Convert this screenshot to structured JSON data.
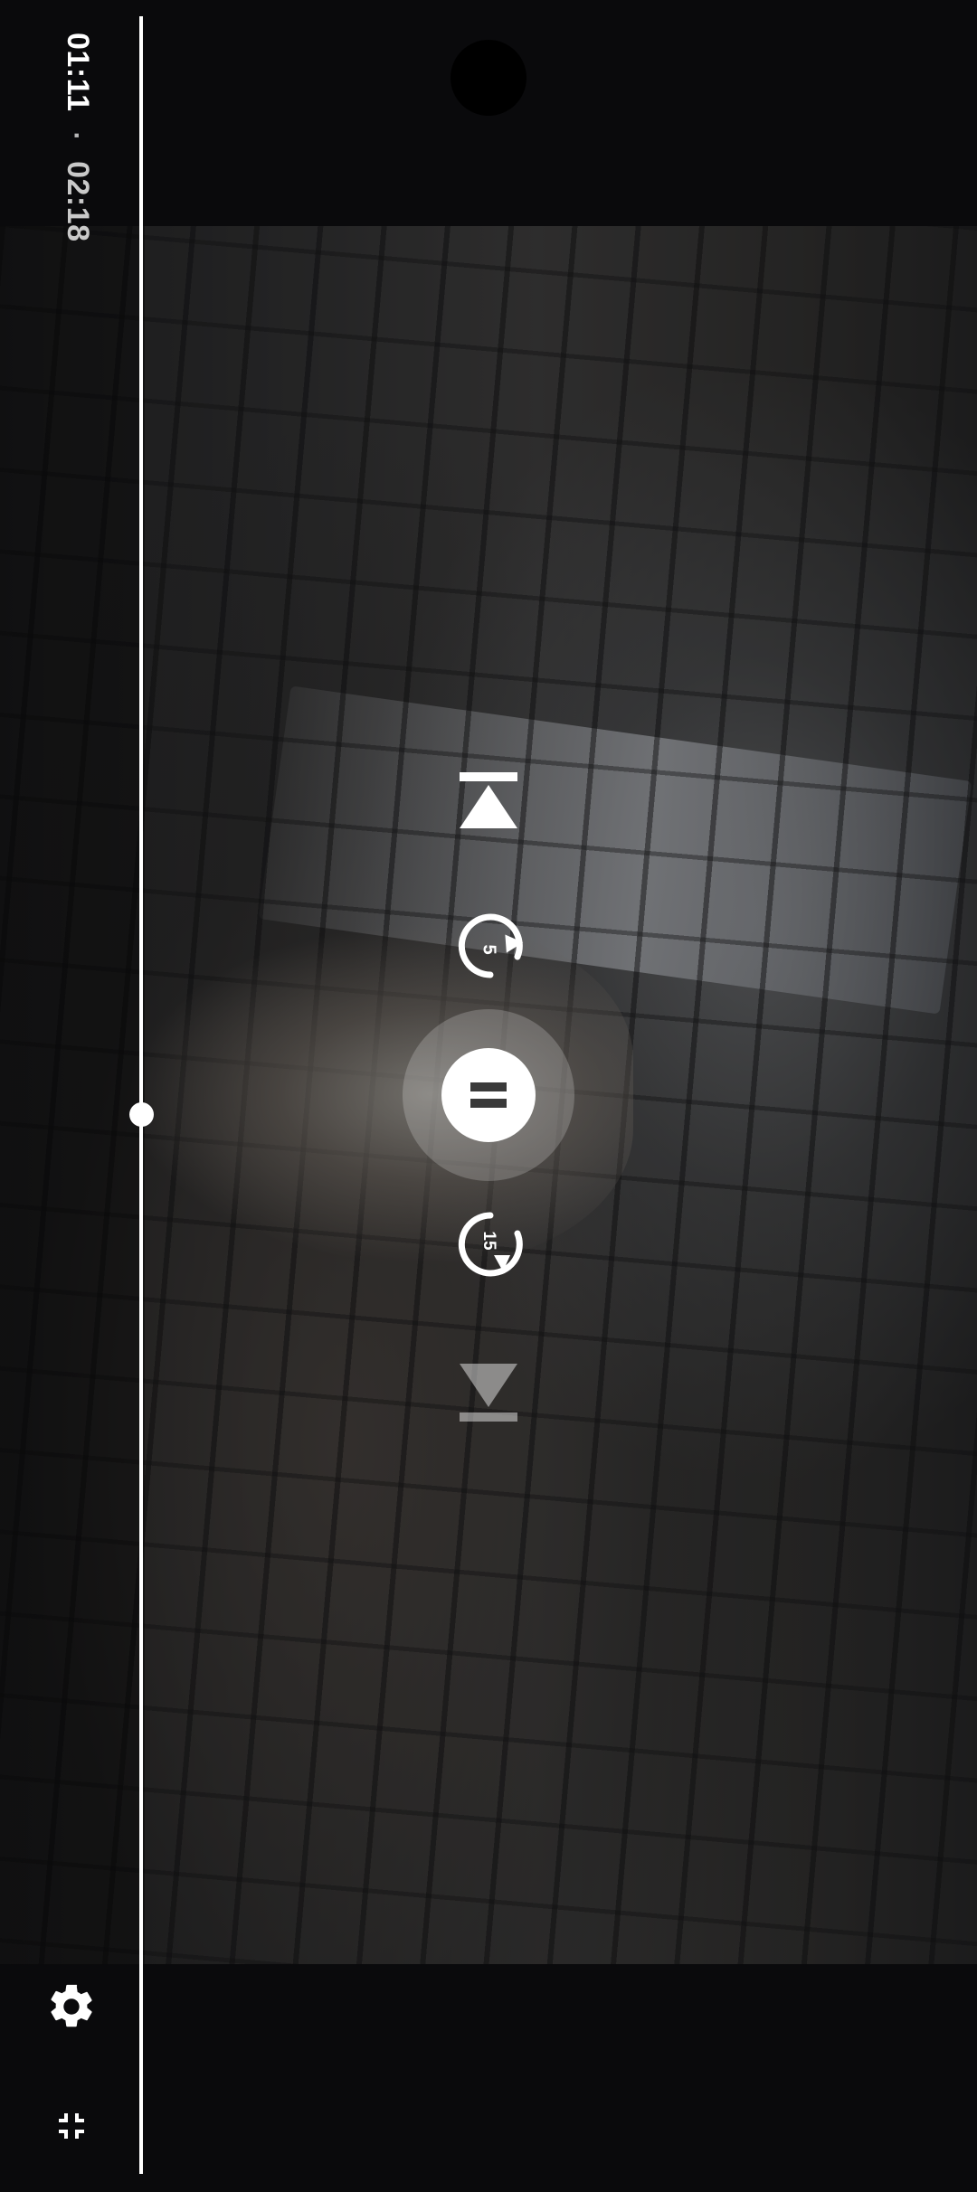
{
  "player": {
    "current_time": "01:11",
    "separator": "·",
    "total_time": "02:18",
    "progress_fraction": 0.51
  },
  "icons": {
    "previous": "skip-previous-icon",
    "rewind": "replay-5-icon",
    "rewind_label": "5",
    "play_pause": "pause-icon",
    "forward": "forward-15-icon",
    "forward_label": "15",
    "next": "skip-next-icon",
    "settings": "gear-icon",
    "fullscreen_exit": "fullscreen-exit-icon"
  },
  "colors": {
    "background": "#0a0a0c",
    "controls": "#ffffff"
  }
}
